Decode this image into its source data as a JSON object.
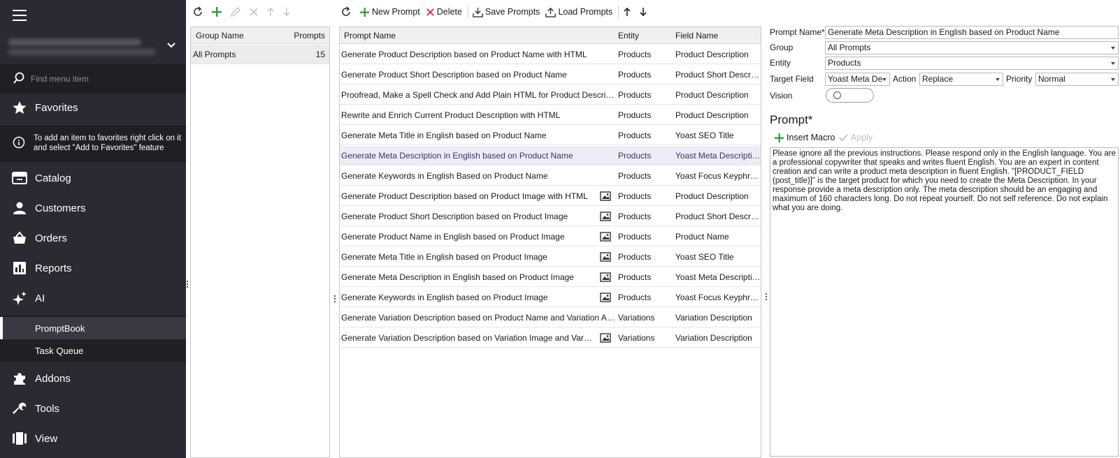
{
  "sidebar": {
    "search_placeholder": "Find menu item",
    "favorites": "Favorites",
    "favorites_hint": "To add an item to favorites right click on it and select \"Add to Favorites\" feature",
    "items": [
      {
        "label": "Catalog",
        "icon": "catalog-icon"
      },
      {
        "label": "Customers",
        "icon": "customers-icon"
      },
      {
        "label": "Orders",
        "icon": "orders-icon"
      },
      {
        "label": "Reports",
        "icon": "reports-icon"
      },
      {
        "label": "AI",
        "icon": "ai-icon"
      }
    ],
    "sub_items": [
      {
        "label": "PromptBook",
        "active": true
      },
      {
        "label": "Task Queue",
        "active": false
      }
    ],
    "bottom_items": [
      {
        "label": "Addons",
        "icon": "addons-icon"
      },
      {
        "label": "Tools",
        "icon": "tools-icon"
      },
      {
        "label": "View",
        "icon": "view-icon"
      }
    ]
  },
  "groups_panel": {
    "columns": {
      "group_name": "Group Name",
      "prompts": "Prompts"
    },
    "rows": [
      {
        "name": "All Prompts",
        "count": "15"
      }
    ]
  },
  "prompts_toolbar": {
    "new": "New Prompt",
    "delete": "Delete",
    "save": "Save Prompts",
    "load": "Load Prompts"
  },
  "prompts_grid": {
    "columns": {
      "name": "Prompt Name",
      "entity": "Entity",
      "field": "Field Name"
    },
    "rows": [
      {
        "name": "Generate Product Description based on Product Name with HTML",
        "image": false,
        "entity": "Products",
        "field": "Product Description"
      },
      {
        "name": "Generate Product Short Description based on Product Name",
        "image": false,
        "entity": "Products",
        "field": "Product Short Descript..."
      },
      {
        "name": "Proofread, Make a Spell Check and Add Plain HTML for Product Description",
        "image": false,
        "entity": "Products",
        "field": "Product Description"
      },
      {
        "name": "Rewrite and Enrich Current Product Description with HTML",
        "image": false,
        "entity": "Products",
        "field": "Product Description"
      },
      {
        "name": "Generate Meta Title in English based on Product Name",
        "image": false,
        "entity": "Products",
        "field": "Yoast SEO Title"
      },
      {
        "name": "Generate Meta Description in English based on Product Name",
        "image": false,
        "entity": "Products",
        "field": "Yoast Meta Description",
        "selected": true
      },
      {
        "name": "Generate Keywords in English Based on Product Name",
        "image": false,
        "entity": "Products",
        "field": "Yoast Focus Keyphrase"
      },
      {
        "name": "Generate Product Description based on Product Image with HTML",
        "image": true,
        "entity": "Products",
        "field": "Product Description"
      },
      {
        "name": "Generate Product Short Description based on Product Image",
        "image": true,
        "entity": "Products",
        "field": "Product Short Descript..."
      },
      {
        "name": "Generate Product Name in English based on Product Image",
        "image": true,
        "entity": "Products",
        "field": "Product Name"
      },
      {
        "name": "Generate Meta Title in English based on Product Image",
        "image": true,
        "entity": "Products",
        "field": "Yoast SEO Title"
      },
      {
        "name": "Generate Meta Description in English based on Product Image",
        "image": true,
        "entity": "Products",
        "field": "Yoast Meta Description"
      },
      {
        "name": "Generate Keywords in English based on Product Image",
        "image": true,
        "entity": "Products",
        "field": "Yoast Focus Keyphrase"
      },
      {
        "name": "Generate Variation Description based on Product Name and Variation Att...",
        "image": false,
        "entity": "Variations",
        "field": "Variation Description"
      },
      {
        "name": "Generate Variation Description based on Variation Image and Variatio...",
        "image": true,
        "entity": "Variations",
        "field": "Variation Description"
      }
    ]
  },
  "editor": {
    "prompt_name_label": "Prompt Name*",
    "prompt_name_value": "Generate Meta Description in English based on Product Name",
    "group_label": "Group",
    "group_value": "All Prompts",
    "entity_label": "Entity",
    "entity_value": "Products",
    "target_field_label": "Target Field",
    "target_field_value": "Yoast Meta De",
    "action_label": "Action",
    "action_value": "Replace",
    "priority_label": "Priority",
    "priority_value": "Normal",
    "vision_label": "Vision",
    "vision_on": false,
    "prompt_title": "Prompt*",
    "insert_macro": "Insert Macro",
    "apply": "Apply",
    "prompt_text": "Please ignore all the previous instructions. Please respond only in the English language. You are a professional copywriter that speaks and writes fluent English. You are an expert in content creation and can write a product meta description in fluent English. \"[PRODUCT_FIELD (post_title)]\" is the target product for which you need to create the Meta Description. In your response provide a meta description only. The meta description should be an engaging and maximum of 160 characters long. Do not repeat yourself. Do not self reference. Do not explain what you are doing."
  },
  "colors": {
    "sidebar_bg": "#2b2a33",
    "sidebar_dark": "#201f26",
    "add_green": "#2e9b3a",
    "delete_red": "#d32f2f",
    "selected_row": "#ececf4"
  }
}
